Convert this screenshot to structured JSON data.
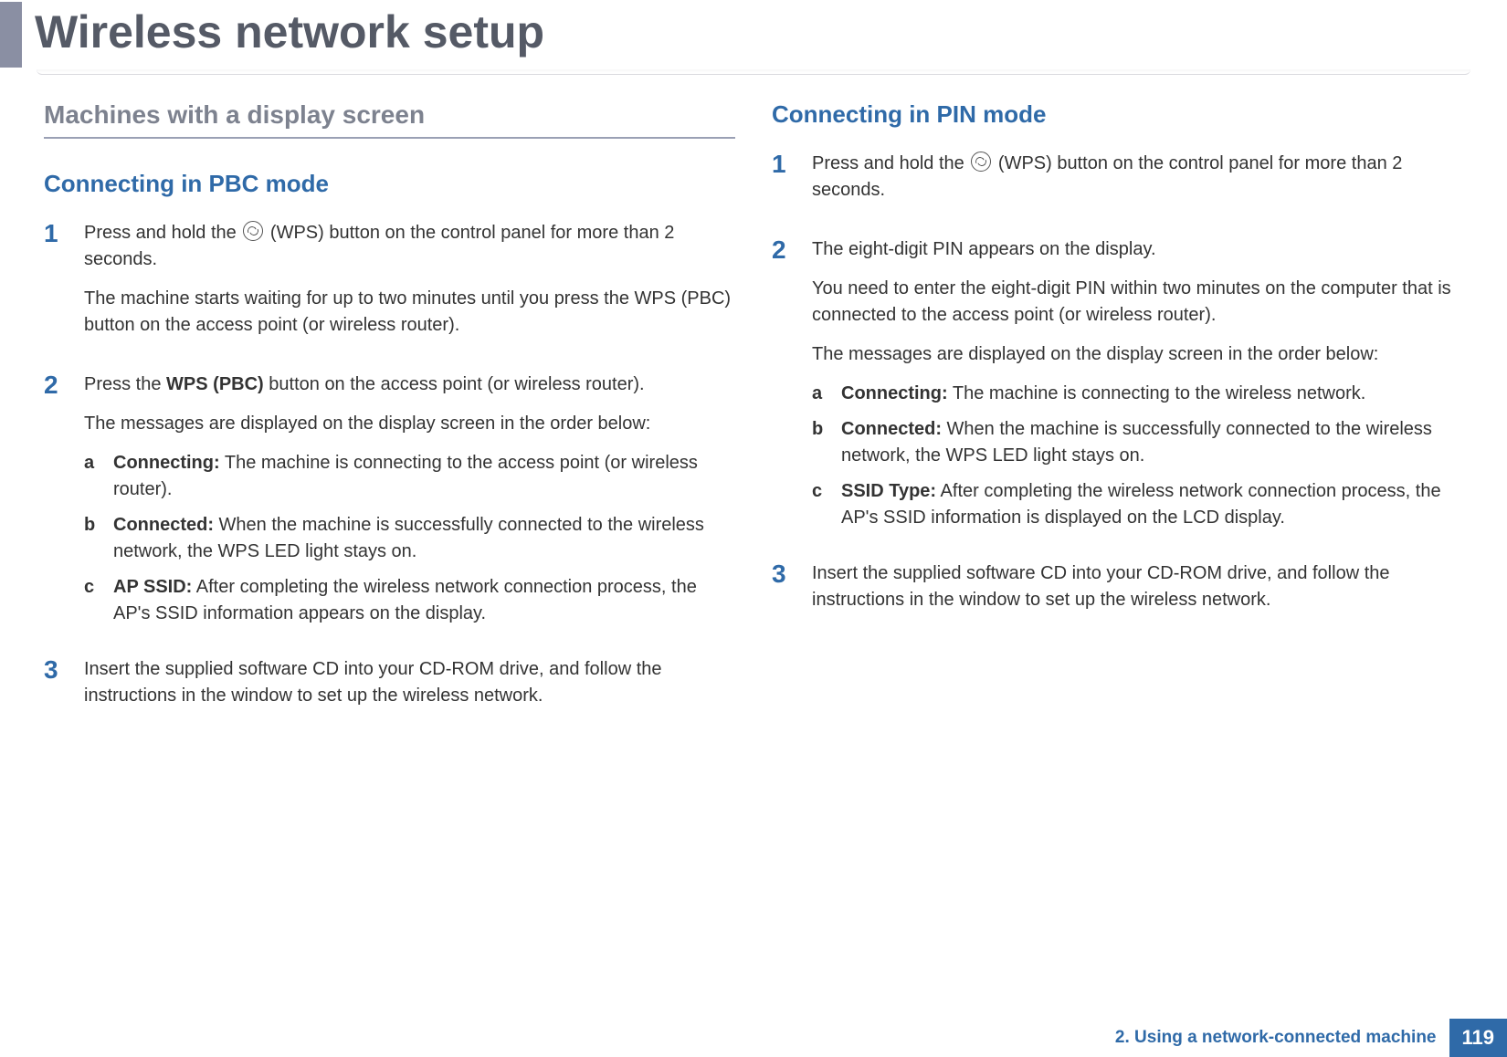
{
  "header": {
    "title": "Wireless network setup"
  },
  "footer": {
    "chapter": "2.  Using a network-connected machine",
    "page": "119"
  },
  "left": {
    "section_heading": "Machines with a display screen",
    "subheading": "Connecting in PBC mode",
    "steps": {
      "s1": {
        "num": "1",
        "p1a": "Press and hold the ",
        "p1b": " (WPS) button on the control panel for more than 2 seconds.",
        "p2": "The machine starts waiting for up to two minutes until you press the WPS (PBC) button on the access point (or wireless router)."
      },
      "s2": {
        "num": "2",
        "p1a": "Press the ",
        "p1bold": "WPS (PBC)",
        "p1b": " button on the access point (or wireless router).",
        "p2": "The messages are displayed on the display screen in the order below:",
        "a": {
          "label": "a",
          "term": "Connecting:",
          "text": " The machine is connecting to the access point (or wireless router)."
        },
        "b": {
          "label": "b",
          "term": "Connected:",
          "text": " When the machine is successfully connected to the wireless network, the WPS LED light stays on."
        },
        "c": {
          "label": "c",
          "term": "AP SSID:",
          "text": " After completing the wireless network connection process, the AP's SSID information appears on the display."
        }
      },
      "s3": {
        "num": "3",
        "p1": "Insert the supplied software CD into your CD-ROM drive, and follow the instructions in the window to set up the wireless network."
      }
    }
  },
  "right": {
    "subheading": "Connecting in PIN mode",
    "steps": {
      "s1": {
        "num": "1",
        "p1a": "Press and hold the ",
        "p1b": " (WPS) button on the control panel for more than 2 seconds."
      },
      "s2": {
        "num": "2",
        "p1": "The eight-digit PIN appears on the display.",
        "p2": "You need to enter the eight-digit PIN within two minutes on the computer that is connected to the access point (or wireless router).",
        "p3": "The messages are displayed on the display screen in the order below:",
        "a": {
          "label": "a",
          "term": "Connecting:",
          "text": " The machine is connecting to the wireless network."
        },
        "b": {
          "label": "b",
          "term": "Connected:",
          "text": " When the machine is successfully connected to the wireless network, the WPS LED light stays on."
        },
        "c": {
          "label": "c",
          "term": "SSID Type:",
          "text": " After completing the wireless network connection process, the AP's SSID information is displayed on the LCD display."
        }
      },
      "s3": {
        "num": "3",
        "p1": "Insert the supplied software CD into your CD-ROM drive, and follow the instructions in the window to set up the wireless network."
      }
    }
  }
}
